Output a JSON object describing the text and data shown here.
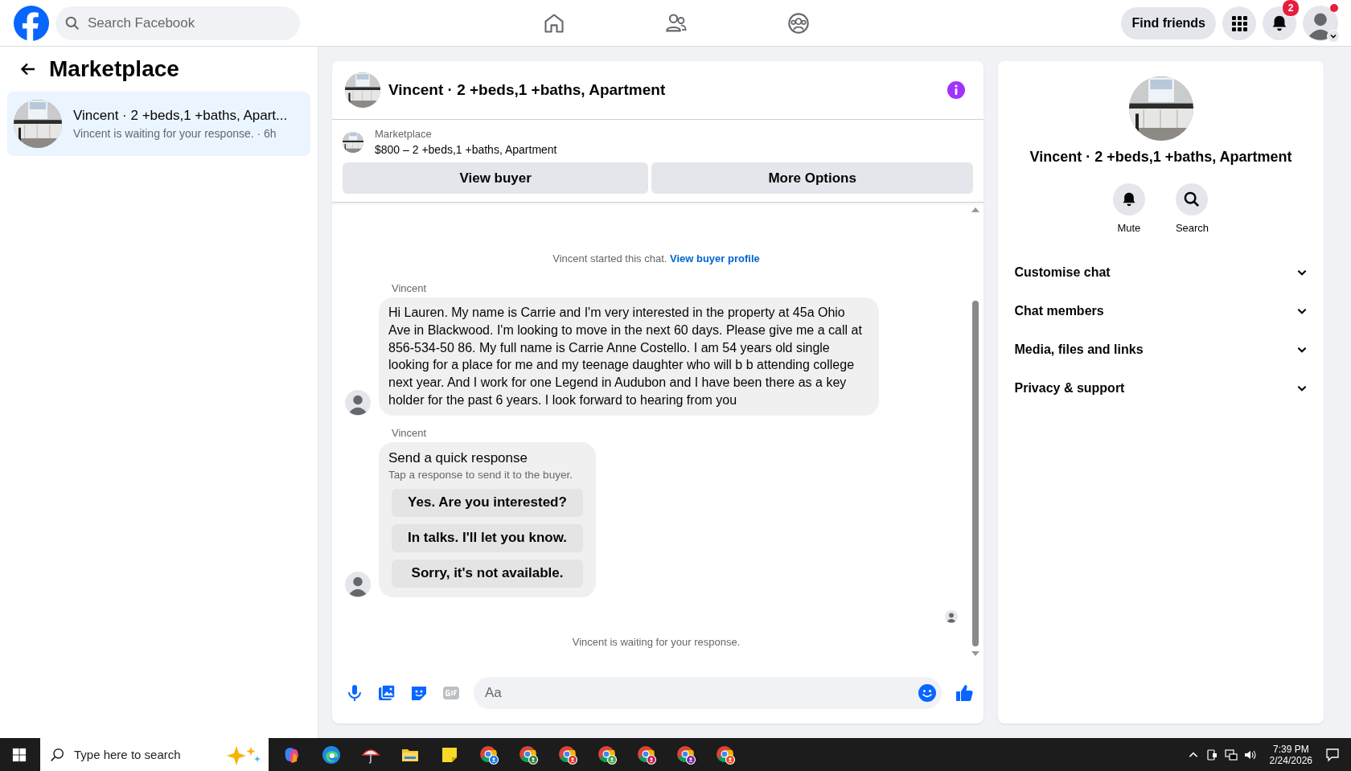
{
  "top_bar": {
    "search": {
      "placeholder": "Search Facebook"
    },
    "nav": [
      {
        "kind": "home"
      },
      {
        "kind": "friends"
      },
      {
        "kind": "groups"
      }
    ],
    "find_friends": "Find friends",
    "notification_count": "2",
    "profile_dot": true
  },
  "sidebar": {
    "title": "Marketplace",
    "conversations": [
      {
        "title": "Vincent · 2 +beds,1 +baths, Apart...",
        "preview": "Vincent is waiting for your response. · 6h",
        "selected": true
      }
    ]
  },
  "chat": {
    "title": "Vincent · 2 +beds,1 +baths, Apartment",
    "listing": {
      "label": "Marketplace",
      "text": "$800 – 2 +beds,1 +baths, Apartment"
    },
    "buttons": [
      "View buyer",
      "More Options"
    ],
    "started": {
      "text": "Vincent started this chat.",
      "link": "View buyer profile"
    },
    "messages": [
      {
        "kind": "text",
        "sender": "Vincent",
        "text": "Hi Lauren. My name is Carrie and I'm very interested in the property at 45a Ohio Ave in Blackwood. I'm looking to move in the next 60 days. Please give me a call at 856-534-50 86. My full name is Carrie Anne Costello. I am 54 years old single looking for a place for me and my teenage daughter who will b b attending college next year. And I work for one Legend in Audubon and I have been there as a key holder for the past 6 years. I look forward to hearing from you"
      },
      {
        "kind": "quick_responses",
        "sender": "Vincent",
        "title": "Send a quick response",
        "subtitle": "Tap a response to send it to the buyer.",
        "options": [
          "Yes. Are you interested?",
          "In talks. I'll let you know.",
          "Sorry, it's not available."
        ]
      }
    ],
    "status": "Vincent is waiting for your response.",
    "composer": {
      "placeholder": "Aa"
    }
  },
  "details": {
    "title": "Vincent · 2 +beds,1 +baths, Apartment",
    "actions": [
      {
        "kind": "mute",
        "label": "Mute"
      },
      {
        "kind": "search",
        "label": "Search"
      }
    ],
    "sections": [
      {
        "label": "Customise chat",
        "expanded": false
      },
      {
        "label": "Chat members",
        "expanded": false
      },
      {
        "label": "Media, files and links",
        "expanded": false
      },
      {
        "label": "Privacy & support",
        "expanded": false
      }
    ]
  },
  "taskbar": {
    "search": {
      "placeholder": "Type here to search"
    },
    "apps": [
      {
        "kind": "swirl"
      },
      {
        "kind": "browser"
      },
      {
        "kind": "umbrella"
      },
      {
        "kind": "folder"
      },
      {
        "kind": "note"
      },
      {
        "kind": "chrome"
      },
      {
        "kind": "chrome"
      },
      {
        "kind": "chrome"
      },
      {
        "kind": "chrome"
      },
      {
        "kind": "chrome"
      },
      {
        "kind": "chrome"
      },
      {
        "kind": "chrome"
      }
    ],
    "time": "7:39 PM",
    "date": "2/24/2026"
  }
}
